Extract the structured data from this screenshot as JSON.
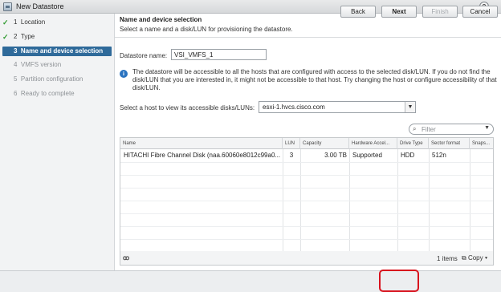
{
  "window": {
    "title": "New Datastore"
  },
  "sidebar": {
    "steps": [
      {
        "num": "1",
        "label": "Location",
        "state": "done"
      },
      {
        "num": "2",
        "label": "Type",
        "state": "done"
      },
      {
        "num": "3",
        "label": "Name and device selection",
        "state": "active"
      },
      {
        "num": "4",
        "label": "VMFS version",
        "state": "future"
      },
      {
        "num": "5",
        "label": "Partition configuration",
        "state": "future"
      },
      {
        "num": "6",
        "label": "Ready to complete",
        "state": "future"
      }
    ]
  },
  "main": {
    "heading": "Name and device selection",
    "subheading": "Select a name and a disk/LUN for provisioning the datastore.",
    "datastore_name_label": "Datastore name:",
    "datastore_name_value": "VSI_VMFS_1",
    "info_text": "The datastore will be accessible to all the hosts that are configured with access to the selected disk/LUN. If you do not find the disk/LUN that you are interested in, it might not be accessible to that host. Try changing the host or configure accessibility of that disk/LUN.",
    "host_label": "Select a host to view its accessible disks/LUNs:",
    "host_value": "esxi-1.hvcs.cisco.com",
    "filter_placeholder": "Filter"
  },
  "table": {
    "columns": [
      "Name",
      "LUN",
      "Capacity",
      "Hardware Accel...",
      "Drive Type",
      "Sector format",
      "Snaps..."
    ],
    "rows": [
      {
        "name": "HITACHI Fibre Channel Disk (naa.60060e8012c99a0...",
        "lun": "3",
        "capacity": "3.00 TB",
        "hw_accel": "Supported",
        "drive_type": "HDD",
        "sector_format": "512n",
        "snapshot": ""
      }
    ]
  },
  "table_footer": {
    "count": "1 items",
    "copy_label": "Copy"
  },
  "buttons": {
    "back": "Back",
    "next": "Next",
    "finish": "Finish",
    "cancel": "Cancel"
  },
  "icons": {
    "check": "check-icon",
    "info": "info-icon",
    "search": "search-icon",
    "binoculars": "binoculars-icon"
  },
  "colors": {
    "active_step": "#2f6a9a",
    "check": "#2f9a2f",
    "info": "#2a74c0",
    "highlight": "#d8121d"
  }
}
